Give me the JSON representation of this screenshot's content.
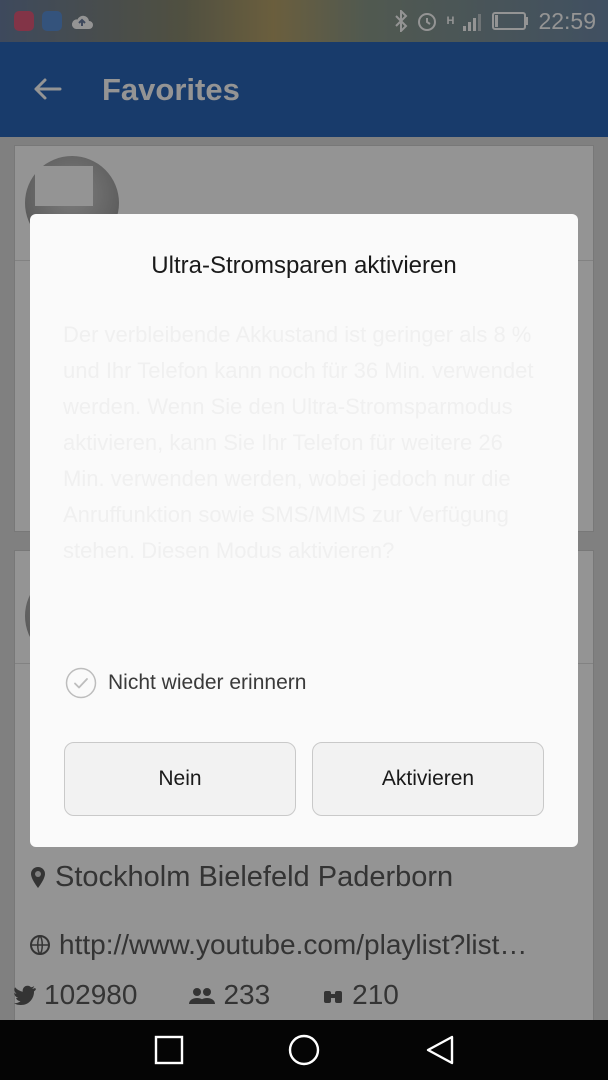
{
  "status_bar": {
    "time": "22:59",
    "network": "H",
    "app_icons": [
      "app-icon",
      "wifi-icon",
      "cloud-upload-icon"
    ],
    "system_icons": [
      "bluetooth-icon",
      "alarm-icon",
      "signal-icon",
      "battery-icon"
    ]
  },
  "app_bar": {
    "title": "Favorites",
    "back_icon": "arrow-back-icon"
  },
  "profile_card": {
    "locations": "Stockholm Bielefeld Paderborn",
    "url": "http://www.youtube.com/playlist?list…",
    "stats": [
      {
        "icon": "twitter-icon",
        "value": "102980"
      },
      {
        "icon": "followers-icon",
        "value": "233"
      },
      {
        "icon": "binoculars-icon",
        "value": "210"
      }
    ]
  },
  "dialog": {
    "title": "Ultra-Stromsparen aktivieren",
    "body": "Der verbleibende Akkustand ist geringer als 8 % und Ihr Telefon kann noch für 36 Min. verwendet werden. Wenn Sie den Ultra-Stromsparmodus aktivieren, kann Sie Ihr Telefon für weitere 26 Min. verwenden werden, wobei jedoch nur die Anruffunktion sowie SMS/MMS zur Verfügung stehen. Diesen Modus aktivieren?",
    "checkbox_label": "Nicht wieder erinnern",
    "checkbox_checked": false,
    "cancel_label": "Nein",
    "confirm_label": "Aktivieren"
  },
  "nav_bar": {
    "buttons": [
      "recents-icon",
      "home-icon",
      "back-icon"
    ]
  },
  "colors": {
    "app_bar": "#2a66b8",
    "dialog_bg": "#fafafa",
    "scrim": "rgba(0,0,0,0.42)"
  }
}
